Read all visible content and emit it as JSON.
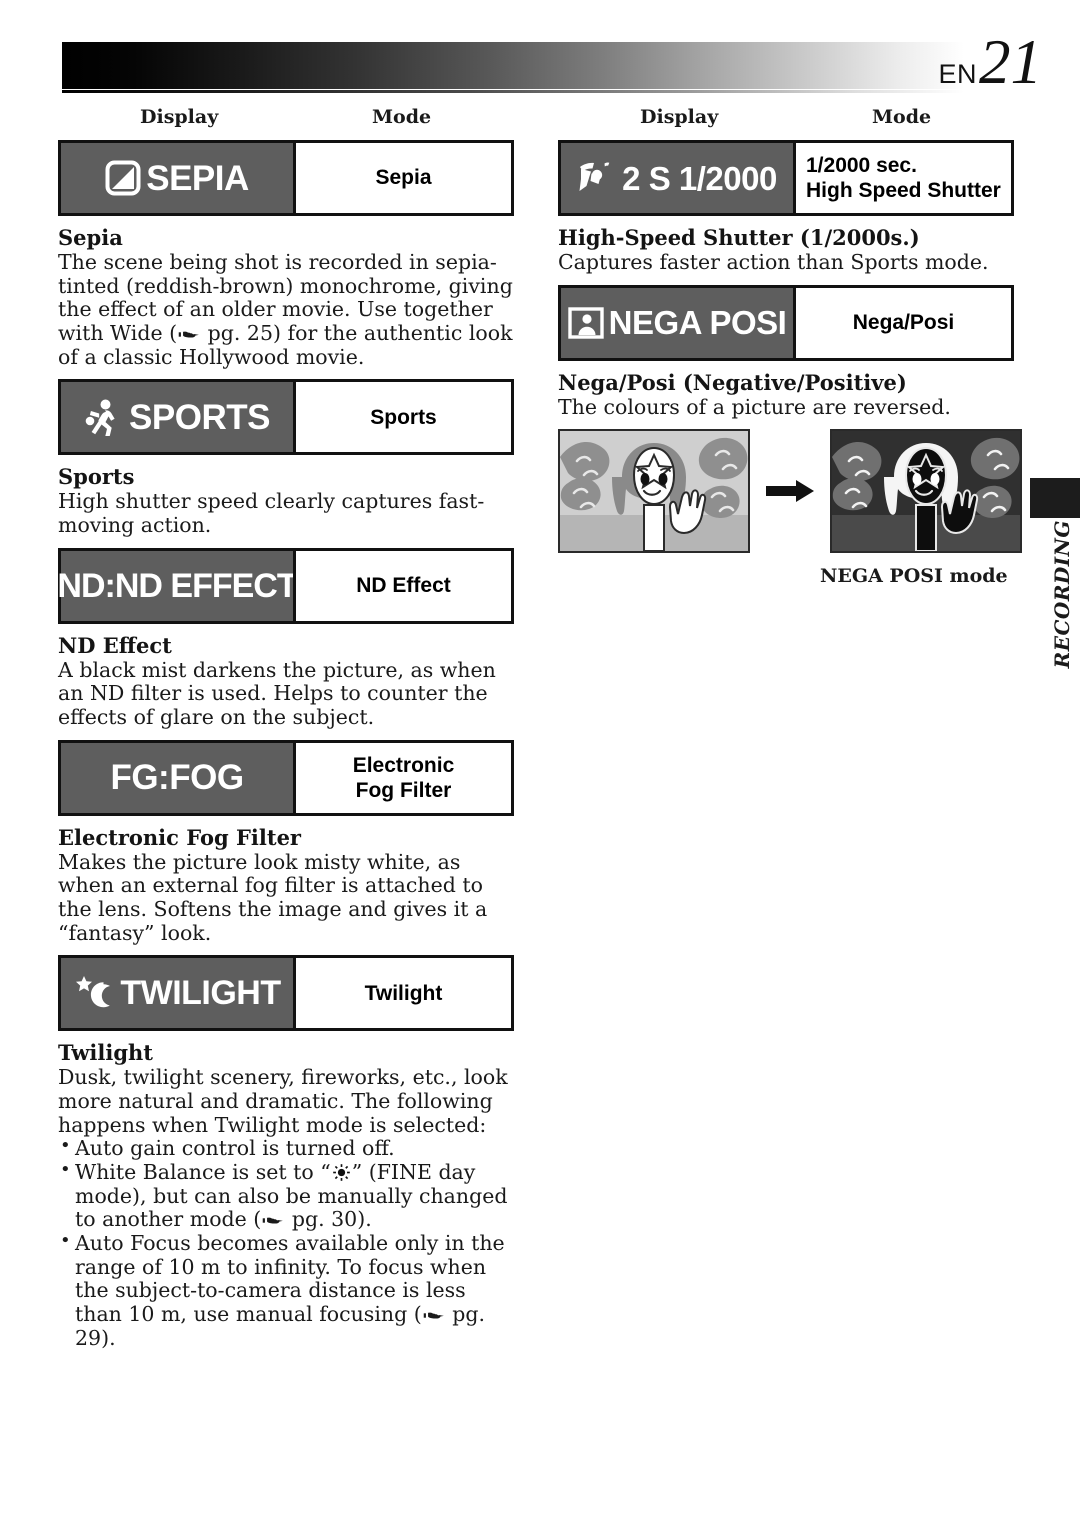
{
  "page": {
    "lang_code": "EN",
    "number": "21",
    "side_tab_label": "RECORDING"
  },
  "column_headers": {
    "display": "Display",
    "mode": "Mode"
  },
  "left_column": {
    "entries": [
      {
        "display_text": "SEPIA",
        "icon": "sepia-diagonal-square-icon",
        "mode_label": "Sepia",
        "heading": "Sepia",
        "body": "The scene being shot is recorded in sepia-tinted (reddish-brown) monochrome, giving the effect of an older movie. Use together with Wide (",
        "body_ref": " pg. 25)",
        "body_tail": " for the authentic look of a classic Hollywood movie."
      },
      {
        "display_text": "SPORTS",
        "icon": "running-figure-icon",
        "mode_label": "Sports",
        "heading": "Sports",
        "body": "High shutter speed clearly captures fast-moving action."
      },
      {
        "display_text": "ND:ND EFFECT",
        "icon": "none",
        "mode_label": "ND Effect",
        "heading": "ND Effect",
        "body": "A black mist darkens the picture, as when an ND filter is used. Helps to counter the effects of glare on the subject."
      },
      {
        "display_text": "FG:FOG",
        "icon": "none",
        "mode_label": "Electronic\nFog Filter",
        "mode_line1": "Electronic",
        "mode_line2": "Fog Filter",
        "heading": "Electronic Fog Filter",
        "body": "Makes the picture look misty white, as when an external fog filter is attached to the lens. Softens the image and gives it a “fantasy” look."
      },
      {
        "display_text": "TWILIGHT",
        "icon": "star-moon-icon",
        "mode_label": "Twilight",
        "heading": "Twilight",
        "body": "Dusk, twilight scenery, fireworks, etc., look more natural and dramatic. The following happens when Twilight mode is selected:",
        "bullets": [
          {
            "text": "Auto gain control is turned off."
          },
          {
            "pre": "White Balance is set to “",
            "icon": "sun-fine-day-icon",
            "mid": "” (FINE day mode), but can also be manually changed to another mode (",
            "ref": " pg. 30).",
            "post": ""
          },
          {
            "pre": "Auto Focus becomes available only in the range of 10 m to infinity. To focus when the subject-to-camera distance is less than 10 m, use manual focusing (",
            "ref": " pg. 29).",
            "post": ""
          }
        ]
      }
    ]
  },
  "right_column": {
    "entries": [
      {
        "display_text_parts": [
          "2",
          "S",
          "1/2000"
        ],
        "display_text": "2 S 1/2000",
        "icon": "high-speed-shutter-figure-icon",
        "mode_line1": "1/2000 sec.",
        "mode_line2": "High Speed Shutter",
        "heading": "High-Speed Shutter (1/2000s.)",
        "body": "Captures faster action than Sports mode."
      },
      {
        "display_text": "NEGA POSI",
        "icon": "portrait-frame-icon",
        "mode_label": "Nega/Posi",
        "heading": "Nega/Posi (Negative/Positive)",
        "body": "The colours of a picture are reversed."
      }
    ],
    "illustration": {
      "left_panel_alt": "woman-waving-normal-colours",
      "arrow": "right-arrow-icon",
      "right_panel_alt": "woman-waving-inverted-colours",
      "caption": "NEGA POSI mode"
    }
  },
  "colors": {
    "display_panel_bg": "#5e5e5e",
    "box_border": "#111111",
    "text": "#1a1a1a",
    "side_tab": "#1c1c1c"
  }
}
